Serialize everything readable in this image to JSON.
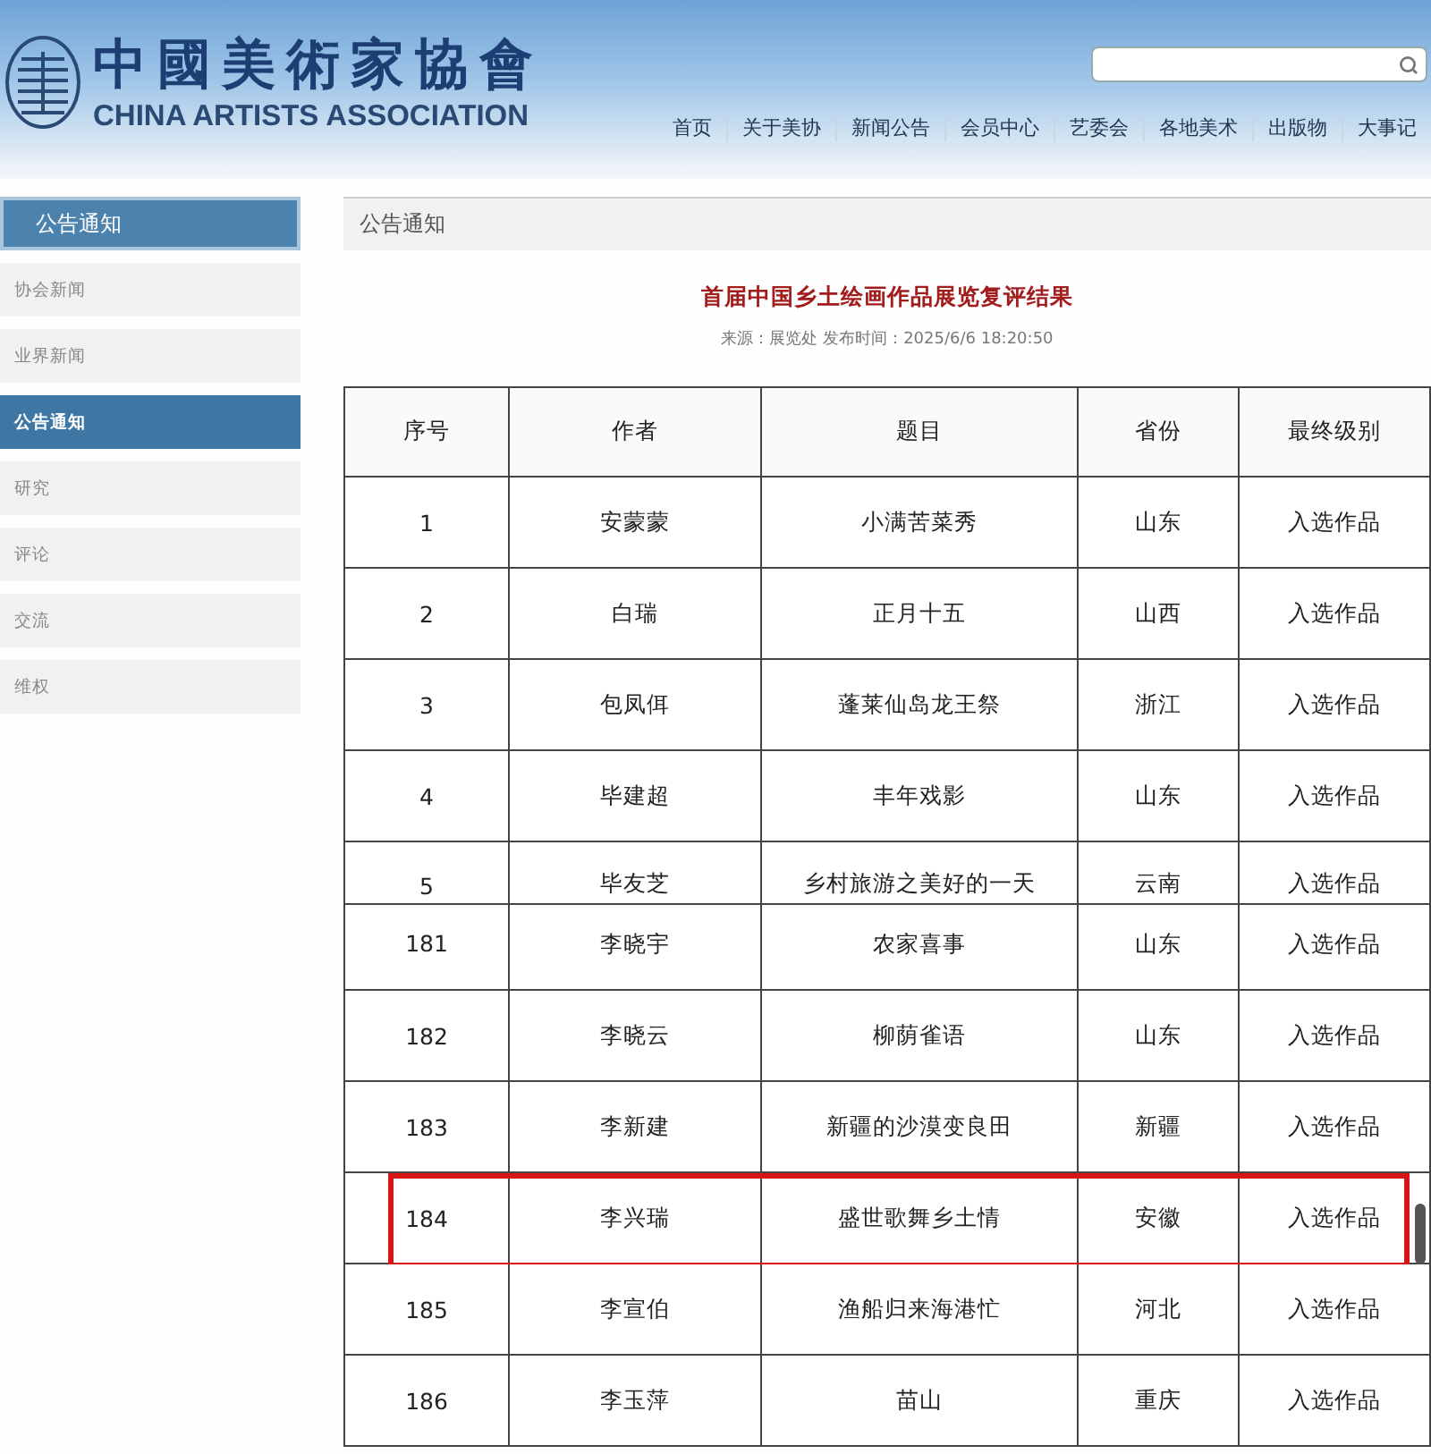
{
  "header": {
    "logo_title": "中國美術家協會",
    "logo_subtitle": "CHINA ARTISTS ASSOCIATION",
    "nav": [
      "首页",
      "关于美协",
      "新闻公告",
      "会员中心",
      "艺委会",
      "各地美术",
      "出版物",
      "大事记"
    ]
  },
  "sidebar": {
    "title": "公告通知",
    "items": [
      {
        "label": "协会新闻",
        "selected": false
      },
      {
        "label": "业界新闻",
        "selected": false
      },
      {
        "label": "公告通知",
        "selected": true
      },
      {
        "label": "研究",
        "selected": false
      },
      {
        "label": "评论",
        "selected": false
      },
      {
        "label": "交流",
        "selected": false
      },
      {
        "label": "维权",
        "selected": false
      }
    ]
  },
  "content": {
    "section_title": "公告通知",
    "article_title": "首届中国乡土绘画作品展览复评结果",
    "meta": "来源：展览处 发布时间：2025/6/6 18:20:50",
    "table": {
      "columns": [
        "序号",
        "作者",
        "题目",
        "省份",
        "最终级别"
      ],
      "rows": [
        {
          "kind": "full",
          "highlighted": false,
          "cells": [
            "1",
            "安蒙蒙",
            "小满苦菜秀",
            "山东",
            "入选作品"
          ]
        },
        {
          "kind": "full",
          "highlighted": false,
          "cells": [
            "2",
            "白瑞",
            "正月十五",
            "山西",
            "入选作品"
          ]
        },
        {
          "kind": "full",
          "highlighted": false,
          "cells": [
            "3",
            "包凤佴",
            "蓬莱仙岛龙王祭",
            "浙江",
            "入选作品"
          ]
        },
        {
          "kind": "full",
          "highlighted": false,
          "cells": [
            "4",
            "毕建超",
            "丰年戏影",
            "山东",
            "入选作品"
          ]
        },
        {
          "kind": "cut_bottom",
          "highlighted": false,
          "cells": [
            "5",
            "毕友芝",
            "乡村旅游之美好的一天",
            "云南",
            "入选作品"
          ]
        },
        {
          "kind": "cut_top",
          "highlighted": false,
          "cells": [
            "181",
            "李晓宇",
            "农家喜事",
            "山东",
            "入选作品"
          ]
        },
        {
          "kind": "full",
          "highlighted": false,
          "cells": [
            "182",
            "李晓云",
            "柳荫雀语",
            "山东",
            "入选作品"
          ]
        },
        {
          "kind": "full",
          "highlighted": false,
          "cells": [
            "183",
            "李新建",
            "新疆的沙漠变良田",
            "新疆",
            "入选作品"
          ]
        },
        {
          "kind": "full",
          "highlighted": true,
          "cells": [
            "184",
            "李兴瑞",
            "盛世歌舞乡土情",
            "安徽",
            "入选作品"
          ]
        },
        {
          "kind": "full",
          "highlighted": false,
          "cells": [
            "185",
            "李宣伯",
            "渔船归来海港忙",
            "河北",
            "入选作品"
          ]
        },
        {
          "kind": "full",
          "highlighted": false,
          "cells": [
            "186",
            "李玉萍",
            "苗山",
            "重庆",
            "入选作品"
          ]
        }
      ]
    }
  }
}
